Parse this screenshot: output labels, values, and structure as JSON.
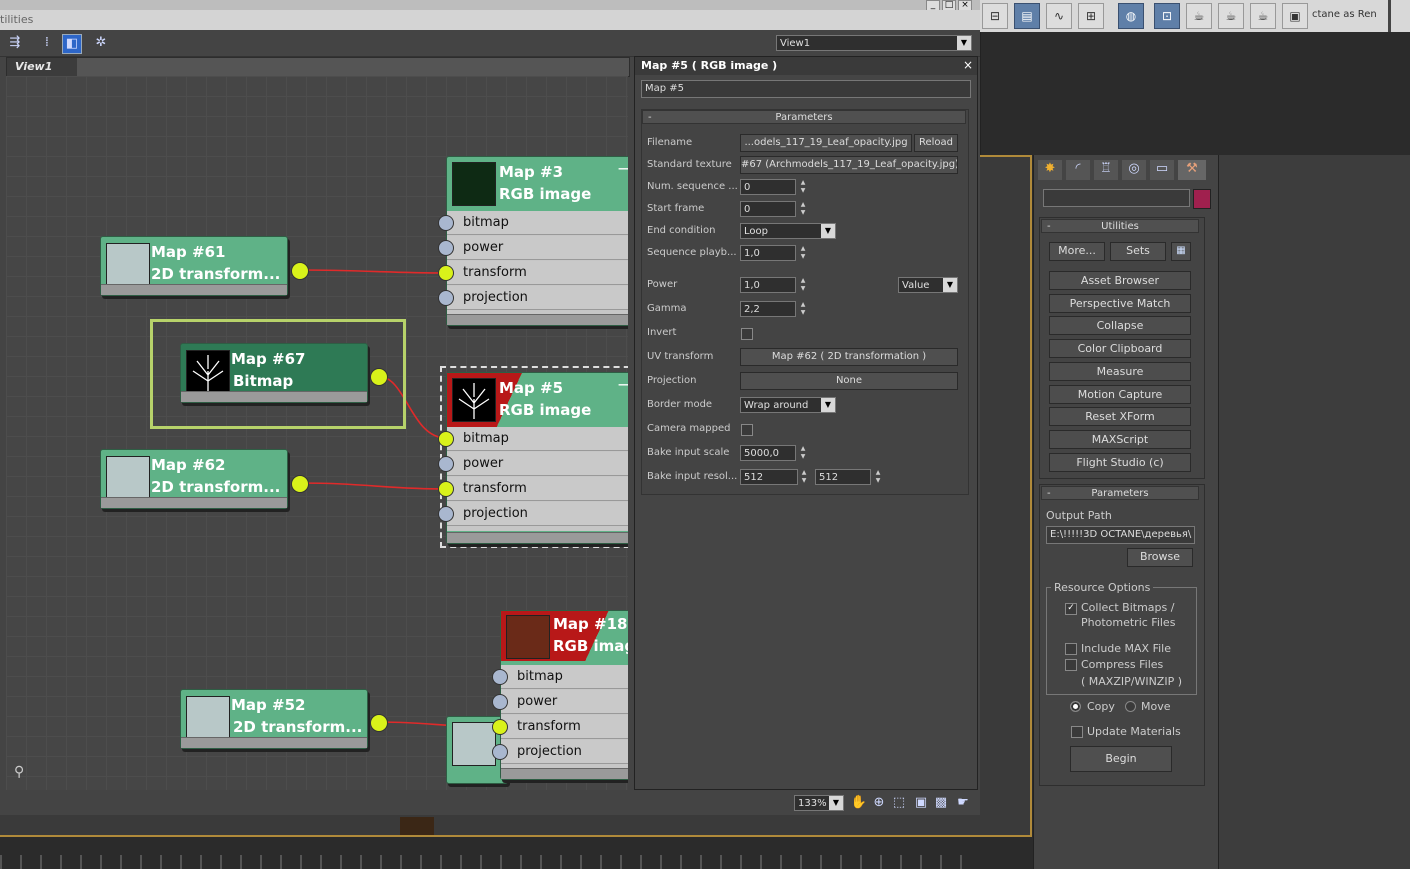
{
  "slate": {
    "menu_label": "tilities",
    "view_dropdown": "View1",
    "view_tab": "View1",
    "zoom": "133%"
  },
  "nodes": {
    "map3": {
      "line1": "Map #3",
      "line2": "RGB image"
    },
    "map61": {
      "line1": "Map #61",
      "line2": "2D transform..."
    },
    "map67": {
      "line1": "Map #67",
      "line2": "Bitmap"
    },
    "map5": {
      "line1": "Map #5",
      "line2": "RGB image"
    },
    "map62": {
      "line1": "Map #62",
      "line2": "2D transform..."
    },
    "map18": {
      "line1": "Map #18",
      "line2": "RGB imag"
    },
    "map52": {
      "line1": "Map #52",
      "line2": "2D transform..."
    },
    "slots": [
      "bitmap",
      "power",
      "transform",
      "projection"
    ]
  },
  "panel": {
    "title": "Map #5  ( RGB image )",
    "name_field": "Map #5",
    "rollout": "Parameters",
    "filename_label": "Filename",
    "filename_value": "...odels_117_19_Leaf_opacity.jpg",
    "reload": "Reload",
    "std_texture_label": "Standard texture",
    "std_texture_value": "#67 (Archmodels_117_19_Leaf_opacity.jpg)",
    "num_seq_label": "Num. sequence ...",
    "num_seq_value": "0",
    "start_frame_label": "Start frame",
    "start_frame_value": "0",
    "end_cond_label": "End condition",
    "end_cond_value": "Loop",
    "seq_play_label": "Sequence playb...",
    "seq_play_value": "1,0",
    "power_label": "Power",
    "power_value": "1,0",
    "power_mode": "Value",
    "gamma_label": "Gamma",
    "gamma_value": "2,2",
    "invert_label": "Invert",
    "uv_label": "UV transform",
    "uv_value": "Map #62  ( 2D transformation )",
    "projection_label": "Projection",
    "projection_value": "None",
    "border_label": "Border mode",
    "border_value": "Wrap around",
    "camera_label": "Camera mapped",
    "bake_scale_label": "Bake input scale",
    "bake_scale_value": "5000,0",
    "bake_res_label": "Bake input resol...",
    "bake_res_w": "512",
    "bake_res_h": "512"
  },
  "topbar": {
    "octane_label": "ctane as Ren"
  },
  "cmd": {
    "utilities_head": "Utilities",
    "more": "More...",
    "sets": "Sets",
    "buttons": [
      "Asset Browser",
      "Perspective Match",
      "Collapse",
      "Color Clipboard",
      "Measure",
      "Motion Capture",
      "Reset XForm",
      "MAXScript",
      "Flight Studio (c)"
    ],
    "params_head": "Parameters",
    "output_path_label": "Output Path",
    "output_path_value": "E:\\!!!!!3D OCTANE\\деревья\\",
    "browse": "Browse",
    "resource_options": "Resource Options",
    "collect_bitmaps": "Collect Bitmaps /",
    "photometric": "Photometric Files",
    "include_max": "Include MAX File",
    "compress_files": "Compress Files",
    "maxzip": "( MAXZIP/WINZIP )",
    "copy": "Copy",
    "move": "Move",
    "update_materials": "Update Materials",
    "begin": "Begin"
  },
  "colors": {
    "node_green": "#5fb287",
    "node_selected": "#2e7a55",
    "socket_active": "#d9f21a",
    "wire_red": "#e02a2a",
    "selection_frame": "#b7d26a"
  }
}
